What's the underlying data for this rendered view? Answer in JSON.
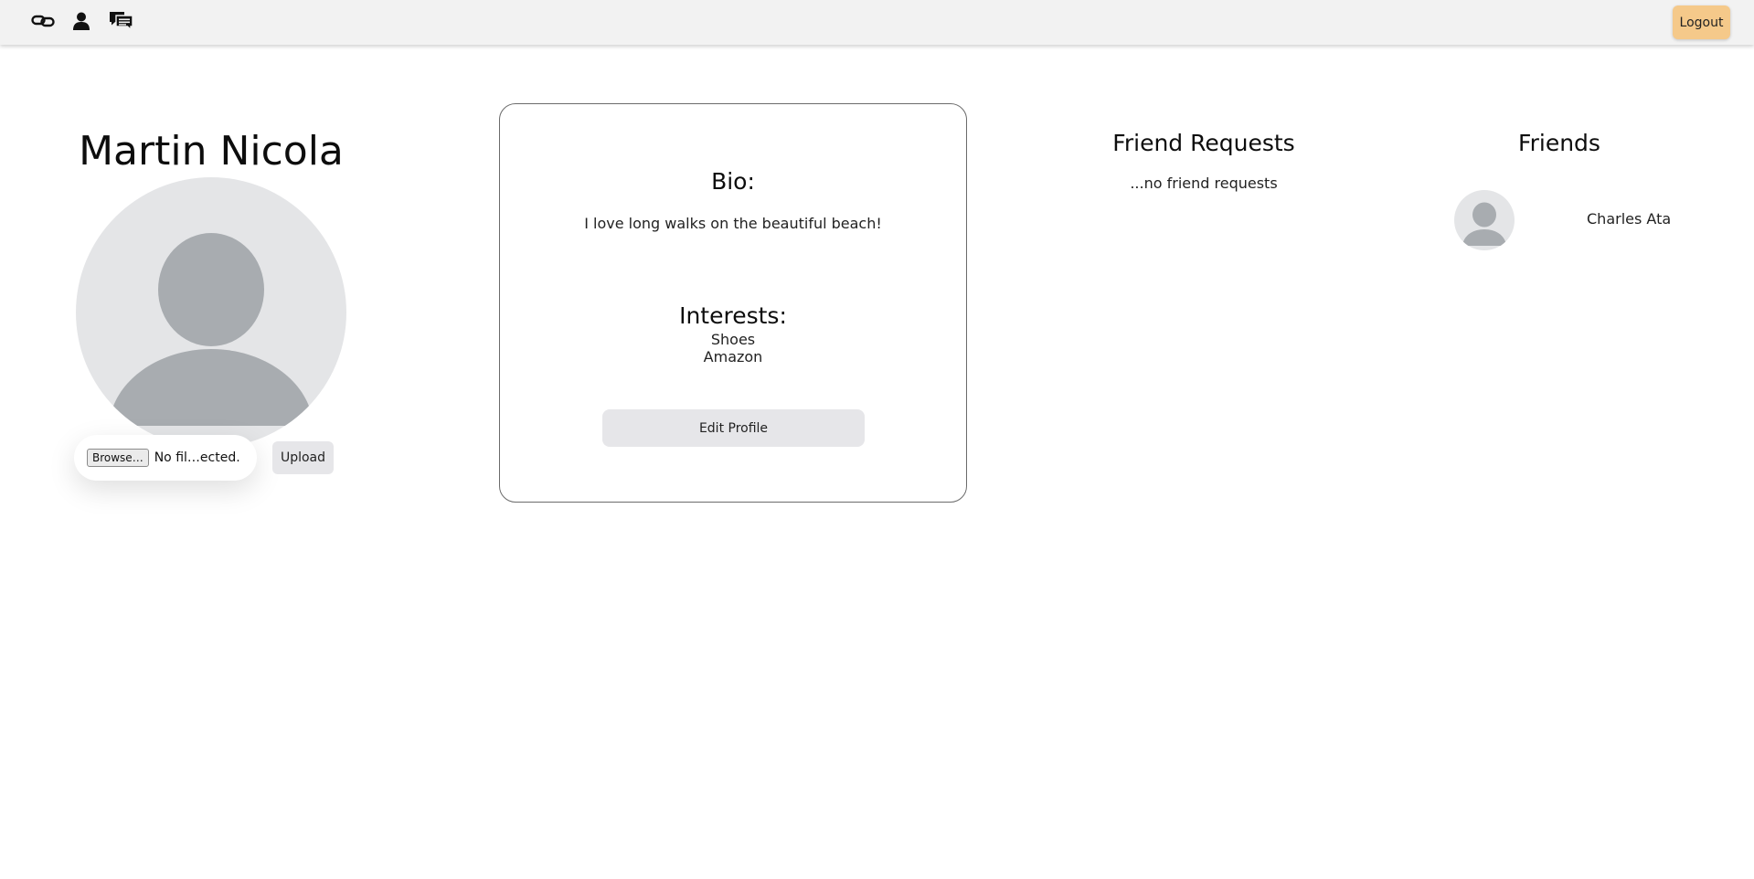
{
  "nav": {
    "icons": [
      "link-icon",
      "user-icon",
      "chat-icon"
    ],
    "logout_label": "Logout"
  },
  "profile": {
    "name": "Martin Nicola",
    "browse_label": "Browse…",
    "file_status": "No fil…ected.",
    "upload_label": "Upload"
  },
  "bio_card": {
    "bio_heading": "Bio:",
    "bio_text": "I love long walks on the beautiful beach!",
    "interests_heading": "Interests:",
    "interests": [
      "Shoes",
      "Amazon"
    ],
    "edit_label": "Edit Profile"
  },
  "friend_requests": {
    "heading": "Friend Requests",
    "empty_text": "...no friend requests"
  },
  "friends": {
    "heading": "Friends",
    "items": [
      {
        "name": "Charles Ata"
      }
    ]
  },
  "colors": {
    "navbar_bg": "#f2f2f2",
    "logout_bg": "#f5c98a",
    "button_bg": "#e6e6e9",
    "avatar_bg": "#e4e5e7",
    "avatar_fg": "#a8acb0"
  }
}
